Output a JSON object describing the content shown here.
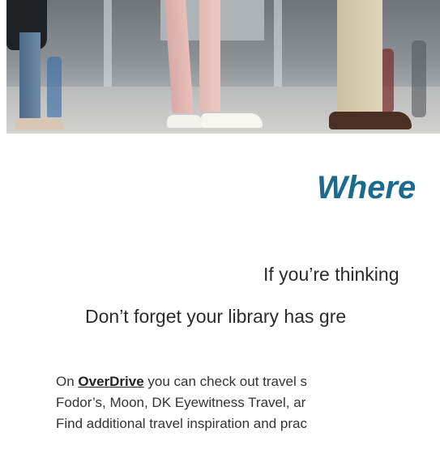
{
  "hero": {
    "image_alt": "travelers' legs and shoes in an airport terminal"
  },
  "heading": "Where",
  "intro": {
    "line1": "If you’re thinking",
    "line2": "Don’t forget your library has gre"
  },
  "body": {
    "line1_prefix": "On ",
    "overdrive_link": "OverDrive",
    "line1_suffix": " you can check out travel s",
    "line2": "Fodor’s, Moon, DK Eyewitness Travel, ar",
    "line3": "Find additional travel inspiration and prac"
  },
  "colors": {
    "heading": "#1b6b8e",
    "text": "#2b2b2b",
    "link": "#222222"
  }
}
